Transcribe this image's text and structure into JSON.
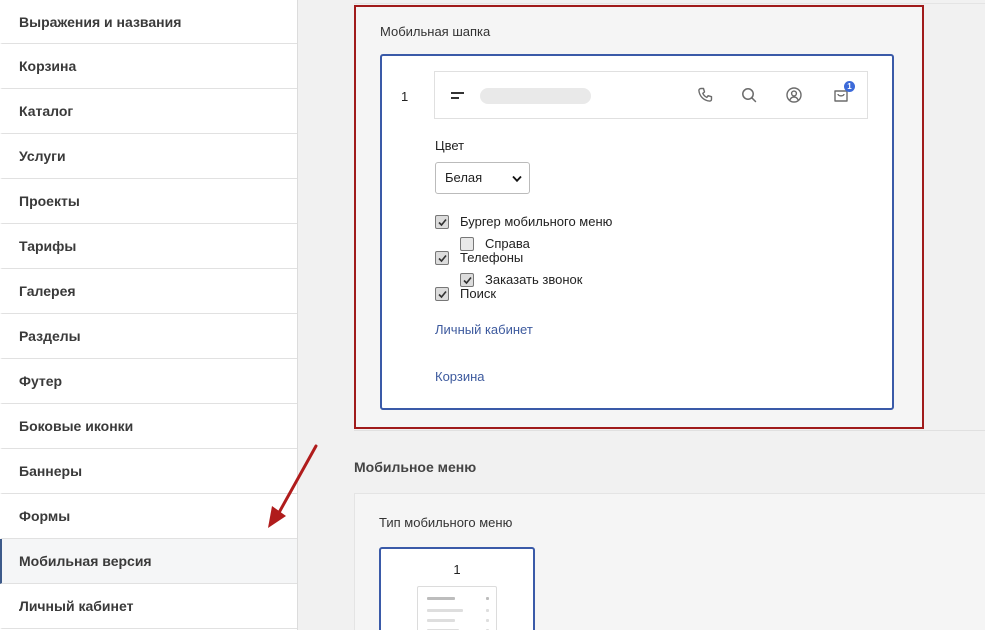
{
  "sidebar": {
    "items": [
      {
        "label": "Выражения и названия"
      },
      {
        "label": "Корзина"
      },
      {
        "label": "Каталог"
      },
      {
        "label": "Услуги"
      },
      {
        "label": "Проекты"
      },
      {
        "label": "Тарифы"
      },
      {
        "label": "Галерея"
      },
      {
        "label": "Разделы"
      },
      {
        "label": "Футер"
      },
      {
        "label": "Боковые иконки"
      },
      {
        "label": "Баннеры"
      },
      {
        "label": "Формы"
      },
      {
        "label": "Мобильная версия"
      },
      {
        "label": "Личный кабинет"
      }
    ],
    "active_label": "Мобильная версия"
  },
  "mobile_header": {
    "section_title": "Мобильная шапка",
    "card_number": "1",
    "cart_badge": "1",
    "color_label": "Цвет",
    "color_value": "Белая",
    "options": {
      "burger": {
        "label": "Бургер мобильного меню",
        "checked": true
      },
      "right": {
        "label": "Справа",
        "checked": false
      },
      "phones": {
        "label": "Телефоны",
        "checked": true
      },
      "callback": {
        "label": "Заказать звонок",
        "checked": true
      },
      "search": {
        "label": "Поиск",
        "checked": true
      }
    },
    "links": {
      "cabinet": "Личный кабинет",
      "cart": "Корзина"
    }
  },
  "mobile_menu": {
    "title": "Мобильное меню",
    "type_label": "Тип мобильного меню",
    "card_number": "1"
  },
  "colors": {
    "highlight_border": "#a01b1b",
    "card_border": "#3a5aa8",
    "link": "#3d5a9e",
    "badge": "#3c6ad9",
    "arrow": "#b01c1c"
  },
  "icons": [
    "burger-icon",
    "phone-icon",
    "search-icon",
    "user-icon",
    "cart-icon",
    "chevron-down-icon",
    "checkmark-icon",
    "arrow-icon"
  ]
}
